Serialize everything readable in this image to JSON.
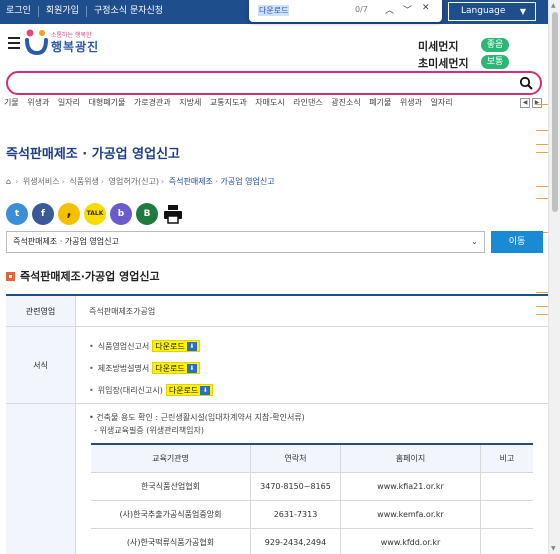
{
  "topbar": {
    "links": [
      "로그인",
      "회원가입",
      "구정소식 문자신청"
    ],
    "language_label": "Language"
  },
  "findbar": {
    "query": "다운로드",
    "count": "0/7"
  },
  "header": {
    "logo_small": "소통하는 행복한",
    "logo_text": "행복광진",
    "fine_dust_label": "미세먼지",
    "fine_dust_status": "좋음",
    "ultrafine_dust_label": "초미세먼지",
    "ultrafine_dust_status": "보통"
  },
  "search": {
    "placeholder": ""
  },
  "keywords": [
    "기물",
    "위생과",
    "일자리",
    "대형폐기물",
    "가로경관과",
    "지방세",
    "교통지도과",
    "자매도시",
    "라인댄스",
    "광진소식",
    "폐기물",
    "위생과",
    "일자리"
  ],
  "page": {
    "title": "즉석판매제조 · 가공업 영업신고",
    "breadcrumb": [
      "위생서비스",
      "식품위생",
      "영업허가(신고)",
      "즉석판매제조 · 가공업 영업신고"
    ],
    "select_value": "즉석판매제조 · 가공업 영업신고",
    "go_button": "이동",
    "section_title": "즉석판매제조·가공업 영업신고"
  },
  "share": {
    "icons": [
      "twitter-icon",
      "facebook-icon",
      "kakaostory-icon",
      "kakaotalk-icon",
      "band-icon",
      "blog-icon",
      "print-icon"
    ],
    "icon_glyphs": [
      "t",
      "f",
      ",",
      "TALK",
      "b",
      "B",
      ""
    ]
  },
  "info_table": {
    "related_label": "관련영업",
    "related_value": "즉석판매제조가공업",
    "forms_label": "서식",
    "forms": [
      {
        "name": "식품영업신고서",
        "download": "다운로드"
      },
      {
        "name": "제조방법설명서",
        "download": "다운로드"
      },
      {
        "name": "위임장(대리신고시)",
        "download": "다운로드"
      }
    ],
    "note1": "건축물 용도 확인 : 근린생활시설(임대차계약서 지참-확인서류)",
    "note2": "- 위생교육필증 (위생관리책임자)"
  },
  "edu_table": {
    "headers": [
      "교육기관명",
      "연락처",
      "홈페이지",
      "비고"
    ],
    "rows": [
      [
        "한국식품산업협회",
        "3470-8150~8165",
        "www.kfia21.or.kr",
        ""
      ],
      [
        "(사)한국추출가공식품업중앙회",
        "2631-7313",
        "www.kemfa.or.kr",
        ""
      ],
      [
        "(사)한국떡류식품가공협회",
        "929-2434,2494",
        "www.kfdd.or.kr",
        ""
      ]
    ]
  },
  "colors": {
    "topbar": "#1f4e8c",
    "search_border": "#d52e72",
    "title": "#1d3f86",
    "go_button": "#1a8ad4",
    "good": "#2bb673",
    "normal": "#2bb673"
  }
}
